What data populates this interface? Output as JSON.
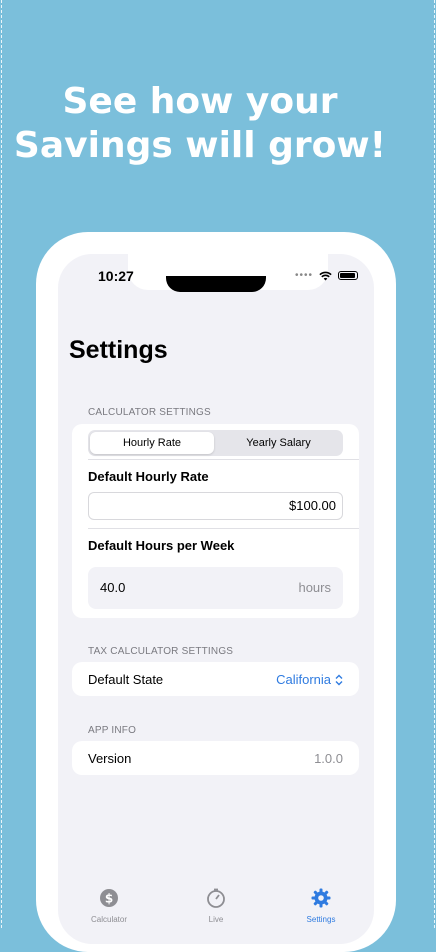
{
  "headline": {
    "line1": "See how your",
    "line2": "Savings will grow!"
  },
  "status_bar": {
    "time": "10:27",
    "dots": "••••"
  },
  "page": {
    "title": "Settings"
  },
  "calculator_settings": {
    "header": "CALCULATOR SETTINGS",
    "segments": [
      "Hourly Rate",
      "Yearly Salary"
    ],
    "selected_segment": "Hourly Rate",
    "default_hourly_rate_label": "Default Hourly Rate",
    "default_hourly_rate_value": "$100.00",
    "default_hours_label": "Default Hours per Week",
    "default_hours_value": "40.0",
    "hours_unit": "hours"
  },
  "tax_settings": {
    "header": "TAX CALCULATOR SETTINGS",
    "default_state_label": "Default State",
    "default_state_value": "California"
  },
  "app_info": {
    "header": "APP INFO",
    "version_label": "Version",
    "version_value": "1.0.0"
  },
  "tabbar": {
    "items": [
      {
        "label": "Calculator",
        "icon": "dollar-circle-icon",
        "active": false
      },
      {
        "label": "Live",
        "icon": "timer-icon",
        "active": false
      },
      {
        "label": "Settings",
        "icon": "gear-icon",
        "active": true
      }
    ]
  },
  "colors": {
    "background": "#7bbfdb",
    "accent": "#2f7be0",
    "screen": "#f2f2f7"
  }
}
